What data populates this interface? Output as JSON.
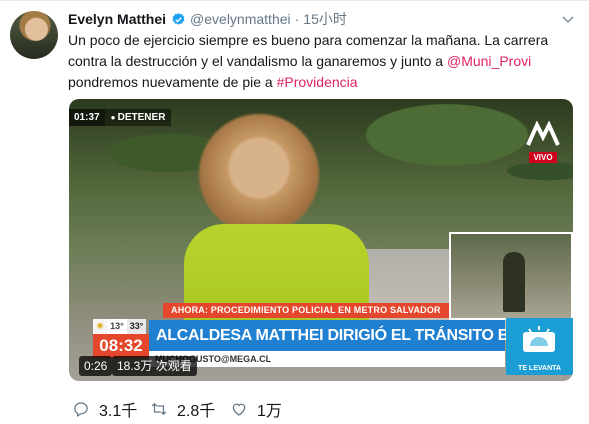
{
  "tweet": {
    "author_name": "Evelyn Matthei",
    "handle": "@evelynmatthei",
    "separator": "·",
    "time": "15小时",
    "text_parts": [
      {
        "text": "Un poco de ejercicio siempre es bueno para comenzar la mañana. La carrera contra la destrucción y el vandalismo la ganaremos y junto a ",
        "link": false
      },
      {
        "text": "@Muni_Provi",
        "link": true
      },
      {
        "text": " pondremos nuevamente de pie a ",
        "link": false
      },
      {
        "text": "#Providencia",
        "link": true
      }
    ],
    "icons": {
      "verified": "verified-badge-icon",
      "caret": "chevron-down-icon"
    }
  },
  "video": {
    "overlay_time": "01:37",
    "overlay_action": "DETENER",
    "channel_live": "VIVO",
    "ticker": "AHORA: PROCEDIMIENTO POLICIAL EN METRO SALVADOR",
    "weather_low": "13°",
    "weather_high": "33°",
    "clock": "08:32",
    "headline": "ALCALDESA MATTHEI DIRIGIÓ EL TRÁNSITO EN PROVIDENCIA",
    "email": "MUCHOGUSTO@MEGA.CL",
    "corner_label": "TE LEVANTA",
    "duration": "0:26",
    "views": "18.3万 次观看"
  },
  "actions": {
    "reply_count": "3.1千",
    "retweet_count": "2.8千",
    "like_count": "1万"
  },
  "colors": {
    "link": "#e0245e",
    "verified": "#1da1f2",
    "muted": "#657786"
  }
}
